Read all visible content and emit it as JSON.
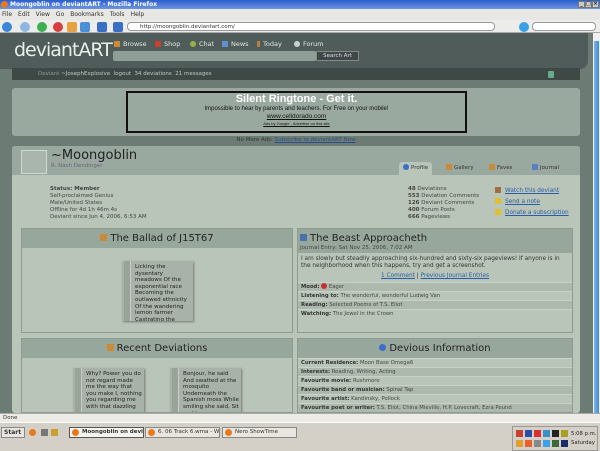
{
  "window": {
    "title": "Moongoblin on deviantART - Mozilla Firefox"
  },
  "menu": [
    "File",
    "Edit",
    "View",
    "Go",
    "Bookmarks",
    "Tools",
    "Help"
  ],
  "address": {
    "url": "http://moongoblin.deviantart.com/"
  },
  "site": {
    "logo": "deviantART",
    "nav": [
      "Browse",
      "Shop",
      "Chat",
      "News",
      "Today",
      "Forum"
    ],
    "search_button": "Search Art"
  },
  "userbar": {
    "prefix": "Deviant",
    "user": "~JosephExplosive",
    "logout": "logout",
    "deviations": "34 deviations",
    "messages": "21 messages"
  },
  "ad": {
    "title": "Silent Ringtone - Get it.",
    "desc": "Impossible to hear by parents and teachers. For Free on your mobile!",
    "url": "www.celldorado.com",
    "footer": "Ads by Google - Advertise on this site"
  },
  "noads": {
    "label": "No More Ads:",
    "link": "Subscribe to deviantART Now"
  },
  "profile": {
    "username": "~Moongoblin",
    "realname": "R. Nash Dendinger",
    "tabs": [
      "Profile",
      "Gallery",
      "Faves",
      "Journal"
    ],
    "status": [
      "Status: Member",
      "Self-proclaimed Genius",
      "Male/United States",
      "Offline for 4d 1h 46m 4s",
      "Deviant since Jun 4, 2006, 6:53 AM"
    ],
    "stats": [
      {
        "n": "48",
        "l": "Deviations"
      },
      {
        "n": "553",
        "l": "Deviation Comments"
      },
      {
        "n": "126",
        "l": "Deviant Comments"
      },
      {
        "n": "400",
        "l": "Forum Posts"
      },
      {
        "n": "666",
        "l": "Pageviews"
      }
    ],
    "actions": [
      "Watch this deviant",
      "Send a note",
      "Donate a subscription"
    ]
  },
  "featured": {
    "title": "The Ballad of J15T67",
    "text": "Licking the dysentary meadows  Of the exponential race  Becoming the outlawed ethnicity  Of the wandering lemon farmer Castrating the"
  },
  "journal": {
    "title": "The Beast Approacheth",
    "date": "Journal Entry: Sat Nov 25, 2006, 7:02 AM",
    "body": "I am slowly but steadily approaching six-hundred and sixty-six pageviews! If anyone is in the neighborhood when this happens, try and get a screenshot.",
    "comments": "1 Comment",
    "sep": "|",
    "previous": "Previous Journal Entries",
    "meta": [
      {
        "k": "Mood:",
        "v": "Eager"
      },
      {
        "k": "Listening to:",
        "v": "The wonderful, wonderful Ludwig Van"
      },
      {
        "k": "Reading:",
        "v": "Selected Poems of T.S. Eliot"
      },
      {
        "k": "Watching:",
        "v": "The Jewel in the Crown"
      }
    ]
  },
  "recent": {
    "title": "Recent Deviations",
    "items": [
      "Why?  Power you do not regard made me the way that you make I, nothing you regarding me with that dazzling",
      "Bonjour, he said  And swatted at the mosquito  Underneath the Spanish moss  While smiling she said, Sit and ta"
    ]
  },
  "info": {
    "title": "Devious Information",
    "rows": [
      {
        "k": "Current Residence:",
        "v": "Moon Base Omega6"
      },
      {
        "k": "Interests:",
        "v": "Reading, Writing, Acting"
      },
      {
        "k": "Favourite movie:",
        "v": "Rushmore"
      },
      {
        "k": "Favourite band or musician:",
        "v": "Spinal Tap"
      },
      {
        "k": "Favourite artist:",
        "v": "Kandinsky, Pollock"
      },
      {
        "k": "Favourite poet or writer:",
        "v": "T.S. Eliot, China Mieville, H.P. Lovecraft, Ezra Pound"
      }
    ]
  },
  "statusbar": "Done",
  "taskbar": {
    "start": "Start",
    "tasks": [
      "Moongoblin on devian...",
      "6. 06 Track 6.wma - Win...",
      "Nero ShowTime"
    ],
    "time": "5:08 p.m.",
    "day": "Saturday"
  }
}
